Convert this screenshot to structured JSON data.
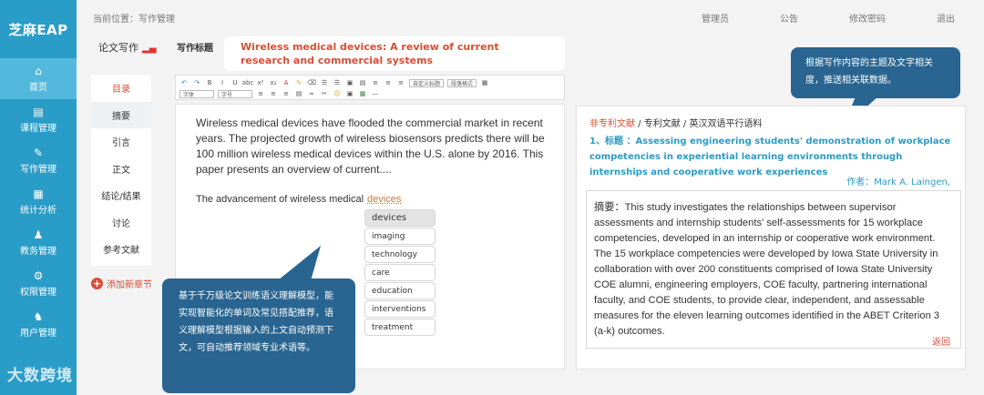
{
  "app": {
    "brand": "芝麻EAP"
  },
  "nav": [
    {
      "icon": "⌂",
      "label": "首页",
      "active": true
    },
    {
      "icon": "▤",
      "label": "课程管理"
    },
    {
      "icon": "✎",
      "label": "写作管理"
    },
    {
      "icon": "▦",
      "label": "统计分析"
    },
    {
      "icon": "♟",
      "label": "教务管理"
    },
    {
      "icon": "⚙",
      "label": "权限管理"
    },
    {
      "icon": "♞",
      "label": "用户管理"
    }
  ],
  "header": {
    "breadcrumb": "当前位置：写作管理",
    "menu": [
      "管理员",
      "公告",
      "修改密码",
      "退出"
    ]
  },
  "writing": {
    "section_label": "论文写作",
    "title_label": "写作标题",
    "title_value": "Wireless medical devices: A review of current research and commercial systems"
  },
  "outline": {
    "items": [
      "目录",
      "摘要",
      "引言",
      "正文",
      "结论/结果",
      "讨论",
      "参考文献"
    ],
    "add_label": "添加新章节"
  },
  "toolbar": {
    "row1": [
      "↶",
      "↷",
      "B",
      "I",
      "U",
      "abc",
      "x²",
      "x₂",
      "A",
      "✎",
      "⌫",
      "☰",
      "☰",
      "▣",
      "▤",
      "≡",
      "≡",
      "≡",
      "自定义标题",
      "段落格式",
      "▦"
    ],
    "font_label": "字体",
    "size_label": "字号"
  },
  "editor": {
    "paragraph": "Wireless medical devices have flooded the commercial market in recent years. The projected growth of wireless biosensors predicts there will be 100 million wireless medical devices within the U.S. alone by 2016. This paper presents an overview of current....",
    "line_prefix": "The advancement of wireless medical",
    "typed_word": "devices"
  },
  "suggestions": [
    "devices",
    "imaging",
    "technology",
    "care",
    "education",
    "interventions",
    "treatment"
  ],
  "callouts": {
    "left": "基于千万级论文训练语义理解模型，能实现智能化的单词及常见搭配推荐，语义理解模型根据输入的上文自动预测下文，可自动推荐领域专业术语等。",
    "right": "根据写作内容的主题及文字相关度，推送相关联数据。"
  },
  "reference": {
    "crumb_active": "非专利文献",
    "crumb_rest": " / 专利文献 / 英汉双语平行语料",
    "title": "1、标题 ：Assessing engineering students' demonstration of workplace competencies in experiential learning environments through internships and cooperative work experiences",
    "author": "作者：Mark A. Laingen,",
    "abstract": "摘要：This study investigates the relationships between supervisor assessments and internship students' self-assessments for 15 workplace competencies, developed in an internship or cooperative work environment. The 15 workplace competencies were developed by Iowa State University in collaboration with over 200 constituents comprised of Iowa State University COE alumni, engineering employers, COE faculty, partnering international faculty, and COE students, to provide clear, independent, and assessable measures for the eleven learning outcomes identified in the ABET Criterion 3 (a-k) outcomes.",
    "back_label": "返回"
  },
  "watermark": "大数跨境"
}
